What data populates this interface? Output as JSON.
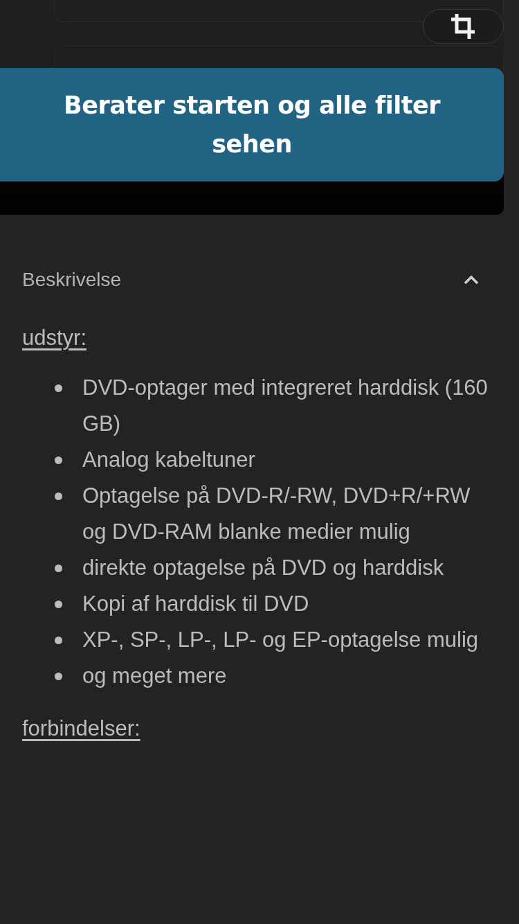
{
  "advisor_button": {
    "label": "Berater starten og alle filter sehen"
  },
  "section": {
    "title": "Beskrivelse",
    "expanded": true,
    "blocks": [
      {
        "kind": "heading",
        "text": "udstyr:"
      },
      {
        "kind": "list",
        "items": [
          "DVD-optager med integreret harddisk (160 GB)",
          "Analog kabeltuner",
          "Optagelse på DVD-R/-RW, DVD+R/+RW og DVD-RAM blanke medier mulig",
          "direkte optagelse på DVD og harddisk",
          "Kopi af harddisk til DVD",
          "XP-, SP-, LP-, LP- og EP-optagelse mulig",
          "og meget mere"
        ]
      },
      {
        "kind": "heading",
        "text": "forbindelser:"
      }
    ]
  }
}
